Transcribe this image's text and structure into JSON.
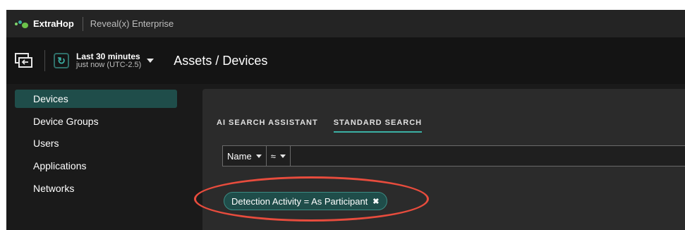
{
  "brand": {
    "logo_text": "ExtraHop",
    "product": "Reveal(x) Enterprise"
  },
  "toolbar": {
    "time_range": "Last 30 minutes",
    "time_sub": "just now (UTC-2.5)",
    "page_title": "Assets / Devices"
  },
  "sidebar": {
    "items": [
      {
        "label": "Devices",
        "active": true
      },
      {
        "label": "Device Groups"
      },
      {
        "label": "Users"
      },
      {
        "label": "Applications"
      },
      {
        "label": "Networks"
      }
    ]
  },
  "main": {
    "tabs": [
      {
        "label": "AI SEARCH ASSISTANT"
      },
      {
        "label": "STANDARD SEARCH",
        "active": true
      }
    ],
    "field_select": "Name",
    "operator_select": "≈",
    "search_value": "",
    "filter_chip": "Detection Activity = As Participant",
    "chip_remove_glyph": "✖"
  },
  "colors": {
    "accent": "#3bb0a4",
    "active_bg": "#1f4d4a",
    "highlight": "#e84c3d"
  }
}
